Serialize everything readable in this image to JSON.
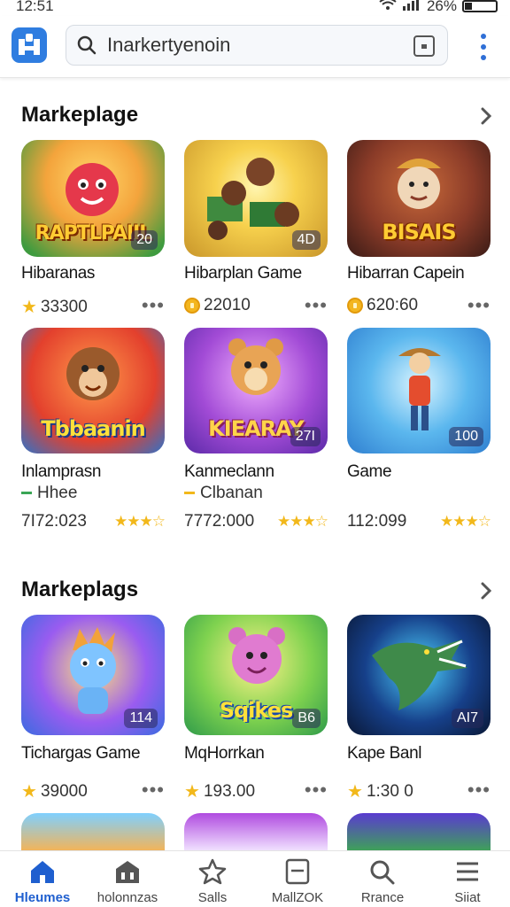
{
  "status": {
    "time": "12:51",
    "battery": "26%"
  },
  "search": {
    "value": "Inarkertyenoin"
  },
  "sections": [
    {
      "title": "Markeplage",
      "cards": [
        {
          "name": "Hibaranas",
          "metric": "33300",
          "metric_icon": "star-icon",
          "badge": "20",
          "brand": "RAPTLPAIIL"
        },
        {
          "name": "Hibarplan Game",
          "metric": "22010",
          "metric_icon": "coin-icon",
          "badge": "4D",
          "brand": ""
        },
        {
          "name": "Hibarran Capein",
          "metric": "620:60",
          "metric_icon": "coin-icon",
          "badge": "",
          "brand": "BISAIS"
        },
        {
          "name": "Inlamprasn",
          "sub": "Hhee",
          "metric": "7I72:023",
          "badge": "",
          "brand": "Tbbaanin"
        },
        {
          "name": "Kanmeclann",
          "sub": "Clbanan",
          "metric": "7772:000",
          "badge": "27I",
          "brand": "KIEARAY"
        },
        {
          "name": "Game",
          "sub": "",
          "metric": "112:099",
          "badge": "100",
          "brand": ""
        }
      ]
    },
    {
      "title": "Markeplags",
      "cards": [
        {
          "name": "Tichargas Game",
          "metric": "39000",
          "metric_icon": "star-icon",
          "badge": "114",
          "brand": ""
        },
        {
          "name": "MqHorrkan",
          "metric": "193.00",
          "metric_icon": "star-icon",
          "badge": "B6",
          "brand": "Sqikes"
        },
        {
          "name": "Kape Banl",
          "metric": "1:30 0",
          "metric_icon": "star-icon",
          "badge": "AI7",
          "brand": ""
        }
      ]
    }
  ],
  "nav": [
    {
      "label": "Hleumes",
      "icon": "home-icon",
      "active": true
    },
    {
      "label": "holonnzas",
      "icon": "store-icon",
      "active": false
    },
    {
      "label": "Salls",
      "icon": "star-outline-icon",
      "active": false
    },
    {
      "label": "MallZOK",
      "icon": "tablet-icon",
      "active": false
    },
    {
      "label": "Rrance",
      "icon": "search-icon",
      "active": false
    },
    {
      "label": "Siiat",
      "icon": "menu-icon",
      "active": false
    }
  ],
  "colors": {
    "accent": "#1f5fcf",
    "star": "#f2b81b",
    "coin": "#f3b61f"
  }
}
